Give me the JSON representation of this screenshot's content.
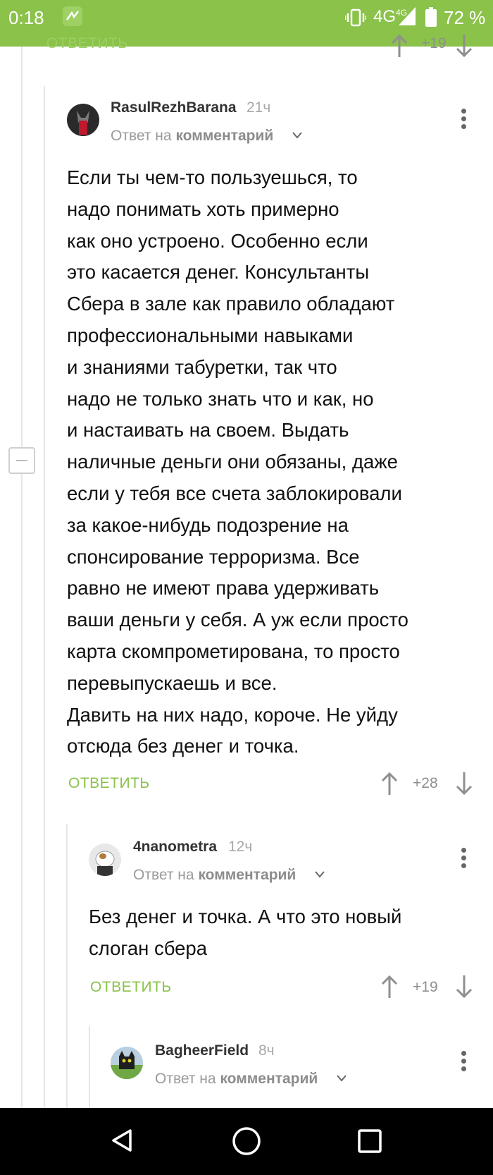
{
  "status_bar": {
    "time": "0:18",
    "network": "4G",
    "network_sup": "4G",
    "battery": "72 %"
  },
  "top_partial": {
    "reply_label": "ОТВЕТИТЬ",
    "score": "+19"
  },
  "comments": [
    {
      "username": "RasulRezhBarana",
      "time": "21ч",
      "reply_prefix": "Ответ на",
      "reply_target": "комментарий",
      "text": "Если ты чем-то пользуешься, то\nнадо понимать хоть примерно\nкак оно устроено. Особенно если\nэто касается денег. Консультанты\nСбера в зале как правило обладают\nпрофессиональными навыками\nи знаниями табуретки, так что\nнадо не только знать что и как, но\nи настаивать на своем. Выдать\nналичные деньги они обязаны, даже\nесли у тебя все счета заблокировали\nза какое-нибудь подозрение на\nспонсирование терроризма. Все\nравно не имеют права удерживать\nваши деньги у себя. А уж если просто\nкарта скомпрометирована, то просто\nперевыпускаешь и все.\nДавить на них надо, короче. Не уйду\nотсюда без денег и точка.",
      "reply_label": "ОТВЕТИТЬ",
      "score": "+28"
    },
    {
      "username": "4nanometra",
      "time": "12ч",
      "reply_prefix": "Ответ на",
      "reply_target": "комментарий",
      "text": "Без денег и точка. А что это новый\nслоган сбера",
      "reply_label": "ОТВЕТИТЬ",
      "score": "+19"
    },
    {
      "username": "BagheerField",
      "time": "8ч",
      "reply_prefix": "Ответ на",
      "reply_target": "комментарий"
    }
  ],
  "colors": {
    "accent": "#8ac24a",
    "nav_bar": "#000000"
  }
}
